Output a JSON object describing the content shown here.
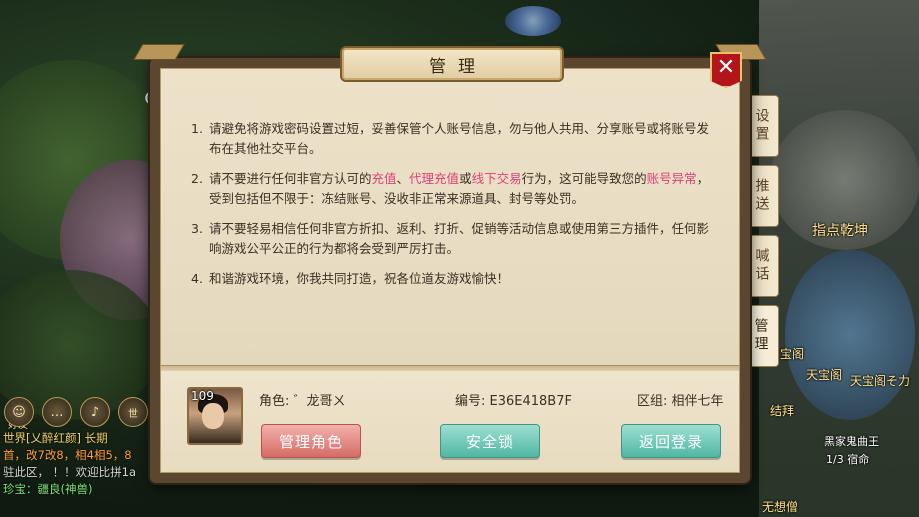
{
  "modal": {
    "title": "管理",
    "close_symbol": "✕"
  },
  "rules": [
    {
      "num": "1.",
      "parts": [
        {
          "t": "请避免将游戏密码设置过短，妥善保管个人账号信息，勿与他人共用、分享账号或将账号发布在其他社交平台。",
          "hl": false
        }
      ]
    },
    {
      "num": "2.",
      "parts": [
        {
          "t": "请不要进行任何非官方认可的",
          "hl": false
        },
        {
          "t": "充值",
          "hl": true
        },
        {
          "t": "、",
          "hl": false
        },
        {
          "t": "代理充值",
          "hl": true
        },
        {
          "t": "或",
          "hl": false
        },
        {
          "t": "线下交易",
          "hl": true
        },
        {
          "t": "行为，这可能导致您的",
          "hl": false
        },
        {
          "t": "账号异常",
          "hl": true
        },
        {
          "t": "，受到包括但不限于：冻结账号、没收非正常来源道具、封号等处罚。",
          "hl": false
        }
      ]
    },
    {
      "num": "3.",
      "parts": [
        {
          "t": "请不要轻易相信任何非官方折扣、返利、打折、促销等活动信息或使用第三方插件，任何影响游戏公平公正的行为都将会受到严厉打击。",
          "hl": false
        }
      ]
    },
    {
      "num": "4.",
      "parts": [
        {
          "t": "和谐游戏环境，你我共同打造，祝各位道友游戏愉快！",
          "hl": false
        }
      ]
    }
  ],
  "account": {
    "level": "109",
    "role_label": "角色: ゛龙哥ㄨ",
    "id_label": "编号: E36E418B7F",
    "zone_label": "区组: 相伴七年"
  },
  "buttons": {
    "manage_role": "管理角色",
    "security_lock": "安全锁",
    "back_login": "返回登录"
  },
  "side_tabs": [
    "设置",
    "推送",
    "喊话",
    "管理"
  ],
  "chat": {
    "line1": "世界[乂醉红颜]  长期",
    "line2": "首，改7改8，相4相5，8",
    "line3": "驻此区，         ！！欢迎比拼1a",
    "line4": "珍宝：疆良(神兽)"
  },
  "world_labels": {
    "friends": "好友",
    "zhidian": "指点乾坤",
    "tianbaoge1": "天宝阁",
    "tianbaoge2": "天宝阁そ力",
    "jiebai": "结拜",
    "wuxiangseng": "无想僧",
    "npc1": "黑家鬼曲王",
    "npc2": "1/3 宿命",
    "baoge": "宝阁",
    "shi": "世"
  },
  "colors": {
    "highlight": "#e0407a",
    "close_red": "#b3151a"
  }
}
